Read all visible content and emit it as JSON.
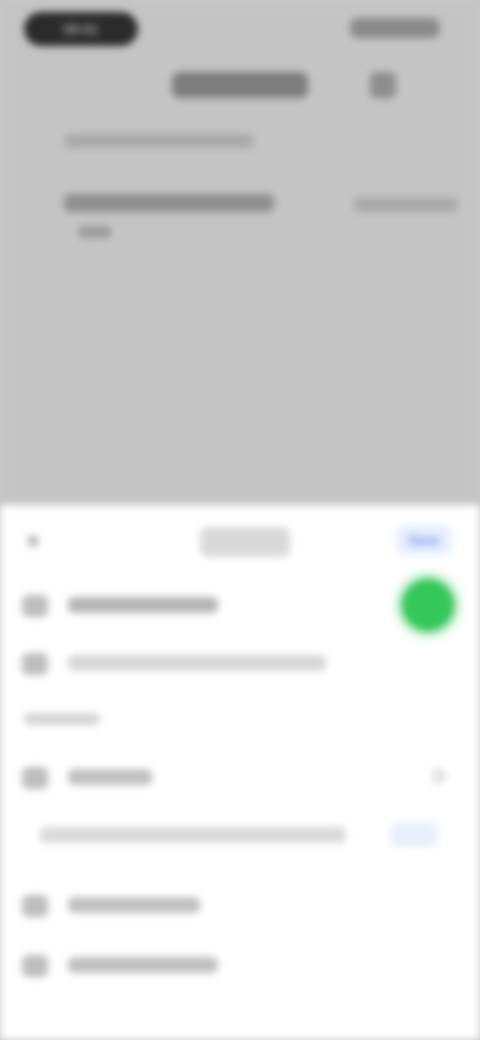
{
  "status": {
    "time": "09:41"
  },
  "sheet": {
    "close_label": "×",
    "save_label": "Save"
  },
  "icons": {
    "close": "close-icon",
    "chevron": "chevron-down-icon"
  },
  "colors": {
    "toggle_on": "#34c759",
    "accent": "#3b73e8",
    "scrim": "#c4c4c4"
  }
}
